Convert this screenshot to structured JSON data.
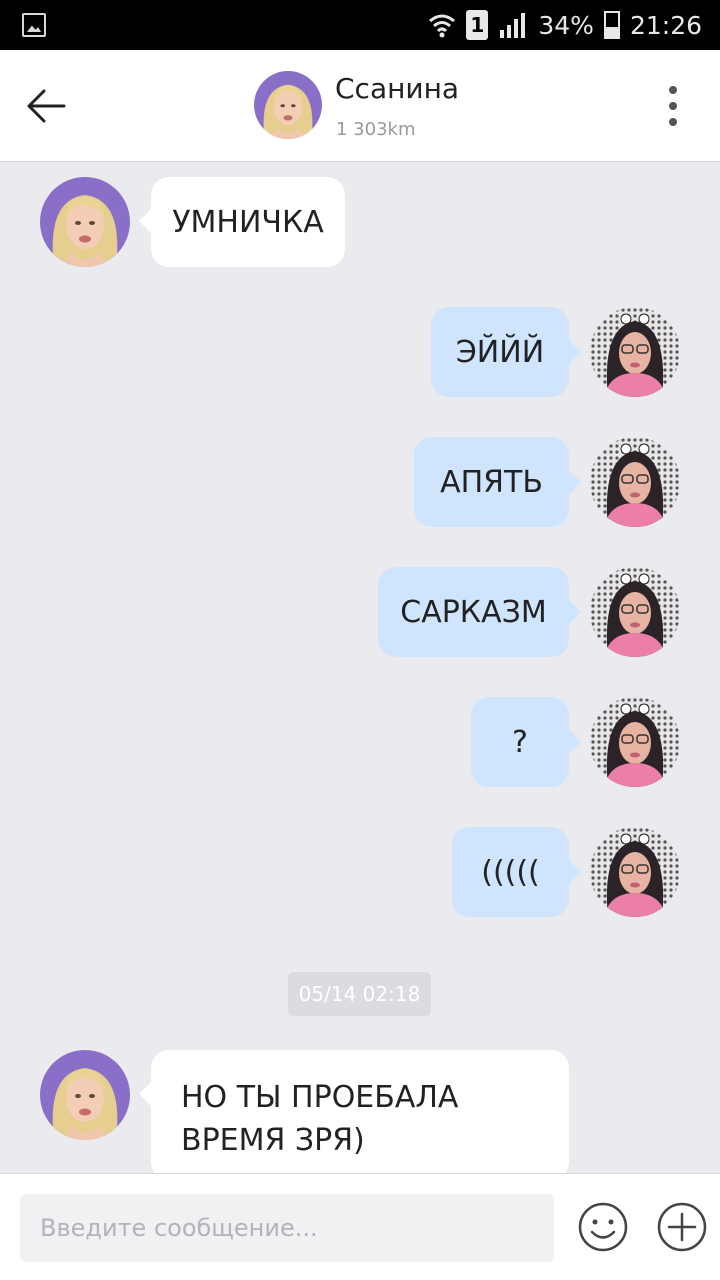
{
  "status_bar": {
    "sim_slot": "1",
    "battery": "34%",
    "time": "21:26"
  },
  "header": {
    "contact_name": "Ссанина",
    "distance": "1 303km"
  },
  "messages": [
    {
      "side": "in",
      "text": "УМНИЧКА"
    },
    {
      "side": "out",
      "text": "ЭЙЙЙ"
    },
    {
      "side": "out",
      "text": "АПЯТЬ"
    },
    {
      "side": "out",
      "text": "САРКАЗМ"
    },
    {
      "side": "out",
      "text": "?"
    },
    {
      "side": "out",
      "text": "((((("
    },
    {
      "side": "in",
      "text": "НО ТЫ ПРОЕБАЛА ВРЕМЯ ЗРЯ)"
    }
  ],
  "timestamp": "05/14 02:18",
  "composer": {
    "placeholder": "Введите сообщение..."
  },
  "colors": {
    "background": "#ebeaef",
    "incoming_bubble": "#ffffff",
    "outgoing_bubble": "#cfe4fd"
  },
  "icons": {
    "back": "arrow-left-icon",
    "more": "more-vertical-icon",
    "emoji": "smiley-icon",
    "attach": "plus-circle-icon"
  }
}
